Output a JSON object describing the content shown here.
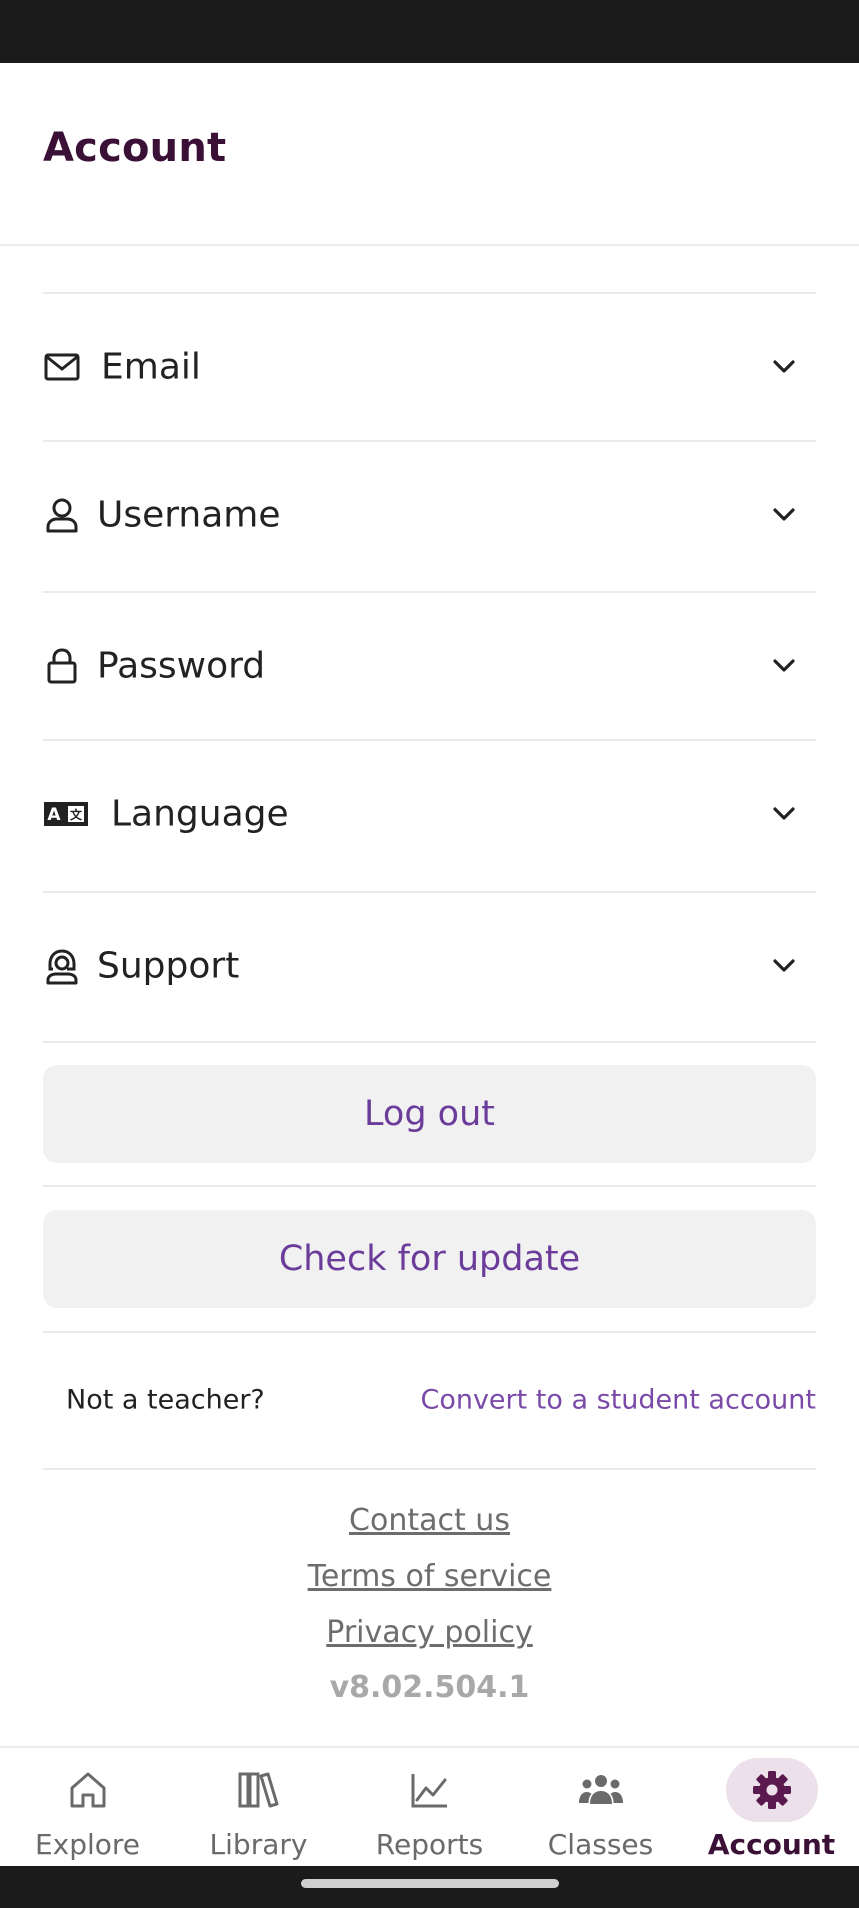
{
  "header": {
    "title": "Account"
  },
  "accordion": [
    {
      "label": "Email",
      "icon": "mail-icon"
    },
    {
      "label": "Username",
      "icon": "user-icon"
    },
    {
      "label": "Password",
      "icon": "lock-icon"
    },
    {
      "label": "Language",
      "icon": "translate-icon"
    },
    {
      "label": "Support",
      "icon": "support-icon"
    }
  ],
  "actions": {
    "logout": "Log out",
    "check_update": "Check for update"
  },
  "convert": {
    "prompt": "Not a teacher?",
    "link": "Convert to a student account"
  },
  "footer": {
    "contact": "Contact us",
    "terms": "Terms of service",
    "privacy": "Privacy policy",
    "version": "v8.02.504.1"
  },
  "nav": [
    {
      "label": "Explore",
      "icon": "home-icon"
    },
    {
      "label": "Library",
      "icon": "books-icon"
    },
    {
      "label": "Reports",
      "icon": "chart-icon"
    },
    {
      "label": "Classes",
      "icon": "people-icon"
    },
    {
      "label": "Account",
      "icon": "gear-icon",
      "active": true
    }
  ],
  "colors": {
    "brand_dark": "#3a1037",
    "accent": "#6b3c9a",
    "button_bg": "#f1f1f2"
  }
}
